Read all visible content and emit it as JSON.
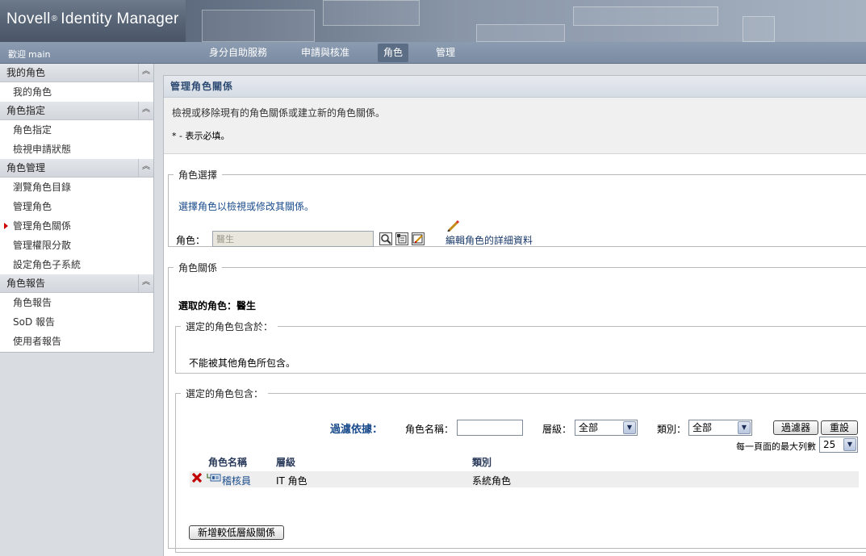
{
  "header": {
    "brand_main": "Novell",
    "brand_reg": "®",
    "brand_product": "Identity Manager",
    "welcome_prefix": "歡迎",
    "welcome_user": "main",
    "tabs": [
      {
        "label": "身分自助服務"
      },
      {
        "label": "申請與核准"
      },
      {
        "label": "角色",
        "active": true
      },
      {
        "label": "管理"
      }
    ]
  },
  "sidebar": {
    "groups": [
      {
        "title": "我的角色",
        "items": [
          "我的角色"
        ]
      },
      {
        "title": "角色指定",
        "items": [
          "角色指定",
          "檢視申請狀態"
        ]
      },
      {
        "title": "角色管理",
        "items": [
          "瀏覽角色目錄",
          "管理角色",
          "管理角色關係",
          "管理權限分散",
          "設定角色子系統"
        ],
        "active_index": 2
      },
      {
        "title": "角色報告",
        "items": [
          "角色報告",
          "SoD 報告",
          "使用者報告"
        ]
      }
    ]
  },
  "main": {
    "title": "管理角色關係",
    "description": "檢視或移除現有的角色關係或建立新的角色關係。",
    "required_note": "* - 表示必填。",
    "role_select": {
      "legend": "角色選擇",
      "instruction": "選擇角色以檢視或修改其關係。",
      "role_label": "角色：",
      "role_value": "醫生",
      "edit_link": "編輯角色的詳細資料"
    },
    "relations": {
      "legend": "角色關係",
      "selected_role": "選取的角色：醫生",
      "contained_in": {
        "legend": "選定的角色包含於：",
        "message": "不能被其他角色所包含。"
      },
      "contains": {
        "legend": "選定的角色包含：",
        "filter_by": "過濾依據：",
        "role_name_label": "角色名稱：",
        "role_name_value": "",
        "level_label": "層級：",
        "level_value": "全部",
        "category_label": "類別：",
        "category_value": "全部",
        "filter_button": "過濾器",
        "reset_button": "重設",
        "max_rows_label": "每一頁面的最大列數",
        "max_rows_value": "25",
        "columns": [
          "角色名稱",
          "層級",
          "類別"
        ],
        "rows": [
          {
            "name": "稽核員",
            "level": "IT 角色",
            "category": "系統角色"
          }
        ],
        "add_button": "新增較低層級關係"
      }
    }
  },
  "colors": {
    "accent_blue": "#1a4c8c",
    "delete_red": "#c00000",
    "nav_bg": "#7b8ca3"
  }
}
